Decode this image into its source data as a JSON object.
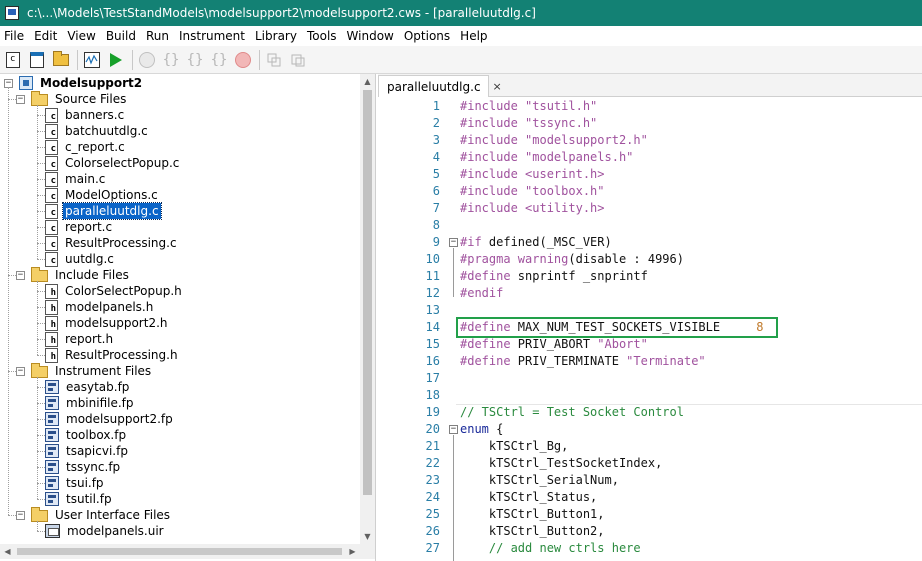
{
  "window": {
    "title": "c:\\...\\Models\\TestStandModels\\modelsupport2\\modelsupport2.cws - [paralleluutdlg.c]"
  },
  "menu": [
    "File",
    "Edit",
    "View",
    "Build",
    "Run",
    "Instrument",
    "Library",
    "Tools",
    "Window",
    "Options",
    "Help"
  ],
  "toolbar": {
    "icons": [
      "new-source-icon",
      "new-header-icon",
      "open-folder-icon",
      "waveform-icon",
      "run-icon",
      "step-over-icon",
      "step-into-icon",
      "step-out-icon",
      "finish-icon",
      "stop-icon",
      "breakpoint-icon",
      "watch-icon"
    ]
  },
  "tree": {
    "project": "Modelsupport2",
    "folders": [
      {
        "label": "Source Files",
        "files": [
          "banners.c",
          "batchuutdlg.c",
          "c_report.c",
          "ColorselectPopup.c",
          "main.c",
          "ModelOptions.c",
          "paralleluutdlg.c",
          "report.c",
          "ResultProcessing.c",
          "uutdlg.c"
        ]
      },
      {
        "label": "Include Files",
        "files": [
          "ColorSelectPopup.h",
          "modelpanels.h",
          "modelsupport2.h",
          "report.h",
          "ResultProcessing.h"
        ]
      },
      {
        "label": "Instrument Files",
        "files": [
          "easytab.fp",
          "mbinifile.fp",
          "modelsupport2.fp",
          "toolbox.fp",
          "tsapicvi.fp",
          "tssync.fp",
          "tsui.fp",
          "tsutil.fp"
        ]
      },
      {
        "label": "User Interface Files",
        "files": [
          "modelpanels.uir"
        ]
      }
    ],
    "selected": "paralleluutdlg.c"
  },
  "editor": {
    "tab_label": "paralleluutdlg.c",
    "tab_close": "×",
    "lines": [
      {
        "n": "1",
        "parts": [
          [
            "pp",
            "#include "
          ],
          [
            "str",
            "\"tsutil.h\""
          ]
        ]
      },
      {
        "n": "2",
        "parts": [
          [
            "pp",
            "#include "
          ],
          [
            "str",
            "\"tssync.h\""
          ]
        ]
      },
      {
        "n": "3",
        "parts": [
          [
            "pp",
            "#include "
          ],
          [
            "str",
            "\"modelsupport2.h\""
          ]
        ]
      },
      {
        "n": "4",
        "parts": [
          [
            "pp",
            "#include "
          ],
          [
            "str",
            "\"modelpanels.h\""
          ]
        ]
      },
      {
        "n": "5",
        "parts": [
          [
            "pp",
            "#include "
          ],
          [
            "str",
            "<userint.h>"
          ]
        ]
      },
      {
        "n": "6",
        "parts": [
          [
            "pp",
            "#include "
          ],
          [
            "str",
            "\"toolbox.h\""
          ]
        ]
      },
      {
        "n": "7",
        "parts": [
          [
            "pp",
            "#include "
          ],
          [
            "str",
            "<utility.h>"
          ]
        ]
      },
      {
        "n": "8",
        "parts": []
      },
      {
        "n": "9",
        "parts": [
          [
            "pp",
            "#if "
          ],
          [
            "tx",
            "defined(_MSC_VER)"
          ]
        ],
        "fold": "-"
      },
      {
        "n": "10",
        "parts": [
          [
            "pp",
            "#pragma "
          ],
          [
            "str",
            "warning"
          ],
          [
            "tx",
            "(disable : 4996)"
          ]
        ]
      },
      {
        "n": "11",
        "parts": [
          [
            "pp",
            "#define "
          ],
          [
            "tx",
            "snprintf _snprintf"
          ]
        ]
      },
      {
        "n": "12",
        "parts": [
          [
            "pp",
            "#endif"
          ]
        ]
      },
      {
        "n": "13",
        "parts": []
      },
      {
        "n": "14",
        "parts": [
          [
            "pp",
            "#define "
          ],
          [
            "tx",
            "MAX_NUM_TEST_SOCKETS_VISIBLE     "
          ],
          [
            "num",
            "8"
          ]
        ]
      },
      {
        "n": "15",
        "parts": [
          [
            "pp",
            "#define "
          ],
          [
            "tx",
            "PRIV_ABORT "
          ],
          [
            "str",
            "\"Abort\""
          ]
        ]
      },
      {
        "n": "16",
        "parts": [
          [
            "pp",
            "#define "
          ],
          [
            "tx",
            "PRIV_TERMINATE "
          ],
          [
            "str",
            "\"Terminate\""
          ]
        ]
      },
      {
        "n": "17",
        "parts": []
      },
      {
        "n": "18",
        "parts": []
      },
      {
        "n": "19",
        "parts": [
          [
            "cm",
            "// TSCtrl = Test Socket Control"
          ]
        ]
      },
      {
        "n": "20",
        "parts": [
          [
            "kw",
            "enum "
          ],
          [
            "tx",
            "{"
          ]
        ],
        "fold": "-"
      },
      {
        "n": "21",
        "parts": [
          [
            "tx",
            "    kTSCtrl_Bg,"
          ]
        ]
      },
      {
        "n": "22",
        "parts": [
          [
            "tx",
            "    kTSCtrl_TestSocketIndex,"
          ]
        ]
      },
      {
        "n": "23",
        "parts": [
          [
            "tx",
            "    kTSCtrl_SerialNum,"
          ]
        ]
      },
      {
        "n": "24",
        "parts": [
          [
            "tx",
            "    kTSCtrl_Status,"
          ]
        ]
      },
      {
        "n": "25",
        "parts": [
          [
            "tx",
            "    kTSCtrl_Button1,"
          ]
        ]
      },
      {
        "n": "26",
        "parts": [
          [
            "tx",
            "    kTSCtrl_Button2,"
          ]
        ]
      },
      {
        "n": "27",
        "parts": [
          [
            "cm",
            "    // add new ctrls here"
          ]
        ]
      }
    ]
  },
  "scroll": {
    "up": "▲",
    "down": "▼",
    "left": "◀",
    "right": "▶"
  },
  "expander": {
    "open": "−"
  }
}
